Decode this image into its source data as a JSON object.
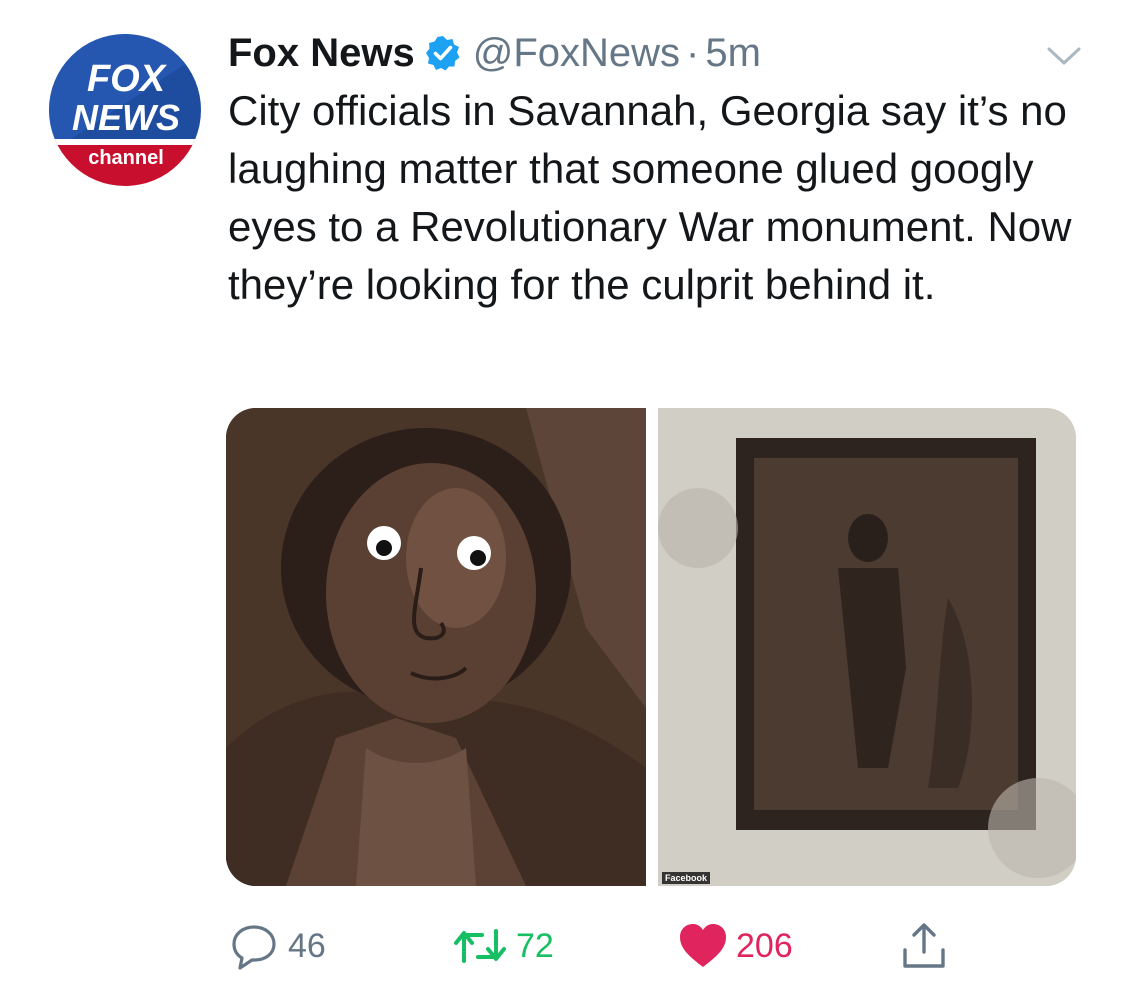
{
  "author": {
    "display_name": "Fox News",
    "handle": "@FoxNews",
    "separator": "·",
    "time": "5m",
    "verified": true,
    "avatar_text": {
      "line1": "FOX",
      "line2": "NEWS",
      "line3": "channel"
    }
  },
  "tweet": {
    "text": "City officials in Savannah, Georgia say it’s no laughing matter that someone glued googly eyes to a Revolutionary War monument. Now they’re looking for the culprit behind it."
  },
  "media": {
    "source_tag": "Facebook"
  },
  "actions": {
    "replies": "46",
    "retweets": "72",
    "likes": "206",
    "liked": true
  },
  "colors": {
    "accent_blue": "#1da1f2",
    "muted": "#657786",
    "retweet_green": "#17bf63",
    "like_red": "#e0245e",
    "fox_blue": "#1e4da0",
    "fox_red": "#c8102e"
  },
  "icons": [
    "fox-news-logo",
    "verified-badge-icon",
    "chevron-down-icon",
    "reply-icon",
    "retweet-icon",
    "heart-icon",
    "share-icon"
  ]
}
